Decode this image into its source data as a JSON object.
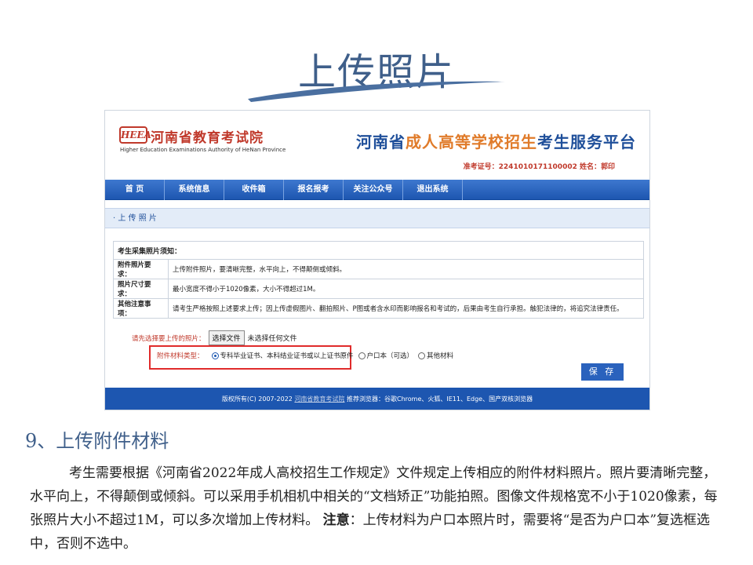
{
  "slide": {
    "title": "上传照片",
    "step_heading": "9、上传附件材料",
    "paragraph_main": "考生需要根据《河南省2022年成人高校招生工作规定》文件规定上传相应的附件材料照片。照片要清晰完整，水平向上，不得颠倒或倾斜。可以采用手机相机中相关的“文档矫正”功能拍照。图像文件规格宽不小于1020像素，每张照片大小不超过1M，可以多次增加上传材料。",
    "note_label": "注意",
    "note_text": "：上传材料为户口本照片时，需要将“是否为户口本”复选框选中，否则不选中。"
  },
  "header": {
    "logo_text": "HEEA",
    "org_name": "河南省教育考试院",
    "org_name_en": "Higher Education Examinations Authority of HeNan Province",
    "platform_prefix": "河南省",
    "platform_accent": "成人高等学校招生",
    "platform_suffix": "考生服务平台",
    "ticket_line": "准考证号：2241010171100002  姓名：郭印"
  },
  "nav": [
    "首 页",
    "系统信息",
    "收件箱",
    "报名报考",
    "关注公众号",
    "退出系统"
  ],
  "section_title": "· 上 传 照 片",
  "notice": {
    "heading": "考生采集照片须知：",
    "rows": [
      {
        "label": "附件照片要求：",
        "text": "上传附件照片，要清晰完整，水平向上，不得颠倒或倾斜。"
      },
      {
        "label": "照片尺寸要求：",
        "text": "最小宽度不得小于1020像素，大小不得超过1M。"
      },
      {
        "label": "其他注意事项：",
        "text": "请考生严格按照上述要求上传；因上传虚假图片、翻拍照片、P图或者含水印而影响报名和考试的，后果由考生自行承担。触犯法律的，将追究法律责任。"
      }
    ]
  },
  "upload": {
    "prompt": "请先选择要上传的照片：",
    "button": "选择文件",
    "status": "未选择任何文件"
  },
  "material_type": {
    "label": "附件材料类型：",
    "options": [
      "专科毕业证书、本科结业证书或以上证书原件",
      "户口本（可选）",
      "其他材料"
    ],
    "selected_index": 0
  },
  "save_label": "保 存",
  "footer": {
    "prefix": "版权所有(C) 2007-2022",
    "link": "河南省教育考试院",
    "suffix": "推荐浏览器：谷歌Chrome、火狐、IE11、Edge、国产双核浏览器"
  },
  "colors": {
    "brand_blue": "#1d56b0",
    "title_blue": "#3f5f8a",
    "accent_red": "#c0392b",
    "accent_orange": "#e07b2a",
    "highlight_box": "#e02b2b"
  }
}
